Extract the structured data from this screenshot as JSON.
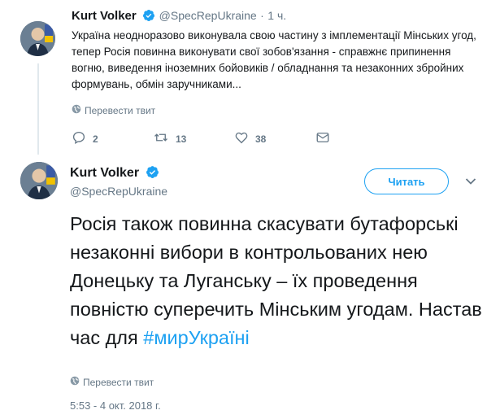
{
  "previous_tweet": {
    "name": "Kurt Volker",
    "handle": "@SpecRepUkraine",
    "separator": "·",
    "time": "1 ч.",
    "text": "Україна неодноразово виконувала свою частину з імплементації Мінських угод, тепер Росія повинна виконувати свої зобов'язання - справжнє припинення вогню, виведення іноземних бойовиків / обладнання та незаконних збройних формувань, обмін заручниками...",
    "translate_label": "Перевести твит",
    "replies": "2",
    "retweets": "13",
    "likes": "38"
  },
  "main_tweet": {
    "name": "Kurt Volker",
    "handle": "@SpecRepUkraine",
    "follow_label": "Читать",
    "text": "Росія також повинна скасувати бутафорські незаконні вибори в контрольованих нею Донецьку та Луганську – їх проведення повністю суперечить Мінським угодам. Настав час для ",
    "hashtag": "#мирУкраїні",
    "translate_label": "Перевести твит",
    "timestamp": "5:53 - 4 окт. 2018 г."
  },
  "colors": {
    "accent": "#1da1f2",
    "muted": "#657786",
    "text": "#14171a"
  },
  "icons": [
    "globe-icon",
    "reply-icon",
    "retweet-icon",
    "like-icon",
    "dm-icon",
    "verified-icon",
    "chevron-down-icon"
  ]
}
